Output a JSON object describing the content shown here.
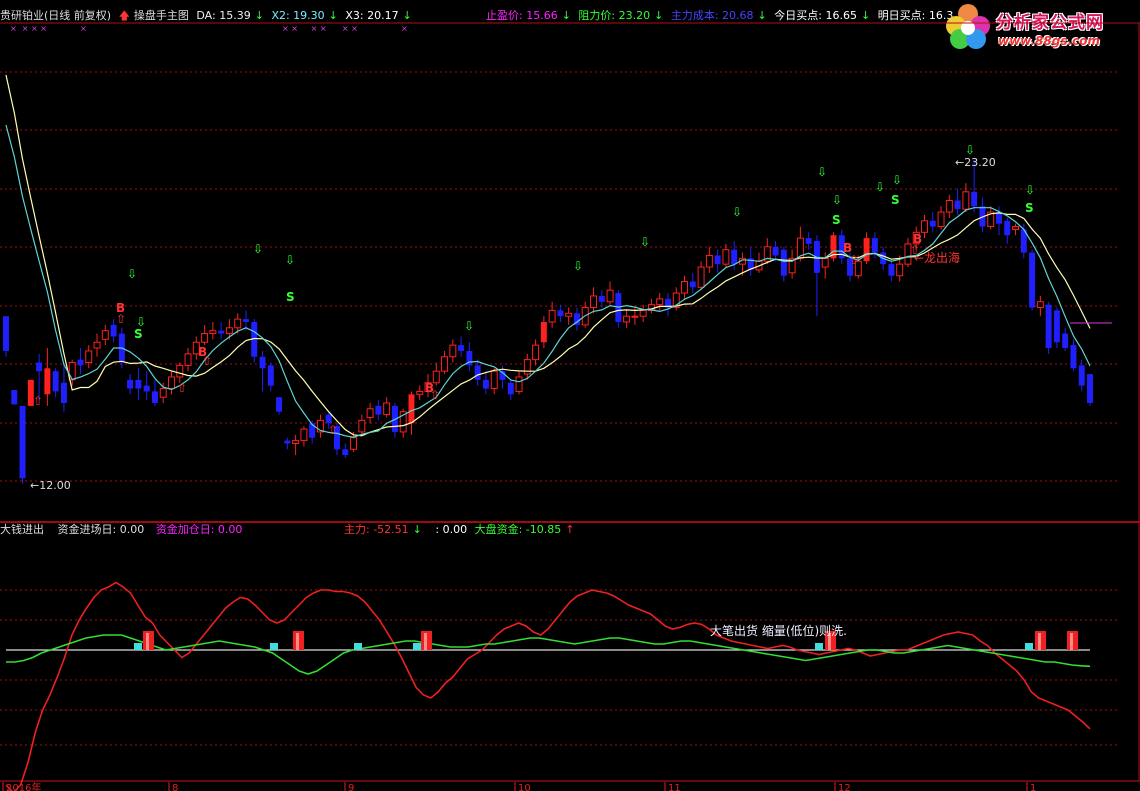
{
  "header": {
    "stock": "贵研铂业(日线 前复权)",
    "indicator": "操盘手主图",
    "da_label": "DA: 15.39",
    "x2_label": "X2: 19.30",
    "x3_label": "X3: 20.17",
    "stop_profit": "止盈价: 15.66",
    "resistance": "阻力价: 23.20",
    "main_cost": "主力成本: 20.68",
    "today_buy": "今日买点: 16.65",
    "tomorrow_buy": "明日买点: 16.3"
  },
  "logo": {
    "name": "分析家公式网",
    "url": "www.88gs.com"
  },
  "sub_header": {
    "name": "大钱进出",
    "fund_entry": "资金进场日: 0.00",
    "fund_add": "资金加仓日: 0.00",
    "main_force": "主力: -52.51",
    "blank_item": ": 0.00",
    "market_fund": "大盘资金: -10.85"
  },
  "colors": {
    "up": "#ff2020",
    "down": "#2020ff",
    "ma_yellow": "#ffffb0",
    "ma_cyan": "#5fd4d4",
    "grid": "#a01010",
    "green_line": "#33dd33",
    "red_line": "#ee2020"
  },
  "chart_data": [
    {
      "type": "candlestick",
      "annotations": {
        "low_label": "12.00",
        "high_label": "23.20",
        "dragon_label": "龙出海",
        "buy_mark": "B",
        "sell_mark": "S"
      },
      "ma_lines": [
        "yellow",
        "cyan"
      ],
      "candles": [
        {
          "o": 17.8,
          "c": 16.6,
          "h": 17.8,
          "l": 16.4
        },
        {
          "o": 15.25,
          "c": 14.75,
          "h": 15.25,
          "l": 14.75
        },
        {
          "o": 14.7,
          "c": 12.2,
          "h": 14.7,
          "l": 12.0
        },
        {
          "o": 14.7,
          "c": 15.6,
          "h": 15.6,
          "l": 14.7
        },
        {
          "o": 16.2,
          "c": 15.9,
          "h": 16.5,
          "l": 14.9
        },
        {
          "o": 15.1,
          "c": 16.0,
          "h": 16.7,
          "l": 14.7
        },
        {
          "o": 15.9,
          "c": 15.2,
          "h": 16.0,
          "l": 15.0
        },
        {
          "o": 15.5,
          "c": 14.8,
          "h": 16.2,
          "l": 14.5
        },
        {
          "o": 15.6,
          "c": 16.2,
          "h": 16.3,
          "l": 15.4
        },
        {
          "o": 16.3,
          "c": 16.1,
          "h": 16.7,
          "l": 15.8
        },
        {
          "o": 16.2,
          "c": 16.6,
          "h": 16.8,
          "l": 16.0
        },
        {
          "o": 16.7,
          "c": 16.9,
          "h": 17.2,
          "l": 16.4
        },
        {
          "o": 17.0,
          "c": 17.3,
          "h": 17.5,
          "l": 16.8
        },
        {
          "o": 17.5,
          "c": 17.1,
          "h": 17.7,
          "l": 16.9
        },
        {
          "o": 17.2,
          "c": 16.2,
          "h": 17.4,
          "l": 16.0
        },
        {
          "o": 15.6,
          "c": 15.3,
          "h": 15.8,
          "l": 15.1
        },
        {
          "o": 15.6,
          "c": 15.3,
          "h": 16.0,
          "l": 14.9
        },
        {
          "o": 15.4,
          "c": 15.2,
          "h": 15.9,
          "l": 14.9
        },
        {
          "o": 15.2,
          "c": 14.8,
          "h": 15.6,
          "l": 14.7
        },
        {
          "o": 15.0,
          "c": 15.3,
          "h": 15.5,
          "l": 14.8
        },
        {
          "o": 15.3,
          "c": 15.7,
          "h": 15.9,
          "l": 15.1
        },
        {
          "o": 15.7,
          "c": 16.1,
          "h": 16.2,
          "l": 15.5
        },
        {
          "o": 16.1,
          "c": 16.5,
          "h": 16.7,
          "l": 15.9
        },
        {
          "o": 16.5,
          "c": 16.9,
          "h": 17.1,
          "l": 16.3
        },
        {
          "o": 16.9,
          "c": 17.2,
          "h": 17.5,
          "l": 16.8
        },
        {
          "o": 17.2,
          "c": 17.3,
          "h": 17.6,
          "l": 17.0
        },
        {
          "o": 17.3,
          "c": 17.2,
          "h": 17.6,
          "l": 17.0
        },
        {
          "o": 17.2,
          "c": 17.4,
          "h": 17.7,
          "l": 17.0
        },
        {
          "o": 17.4,
          "c": 17.7,
          "h": 17.9,
          "l": 17.2
        },
        {
          "o": 17.7,
          "c": 17.6,
          "h": 18.0,
          "l": 17.3
        },
        {
          "o": 17.6,
          "c": 16.4,
          "h": 17.7,
          "l": 16.2
        },
        {
          "o": 16.4,
          "c": 16.0,
          "h": 16.6,
          "l": 15.2
        },
        {
          "o": 16.1,
          "c": 15.4,
          "h": 16.2,
          "l": 15.2
        },
        {
          "o": 15.0,
          "c": 14.5,
          "h": 15.0,
          "l": 14.4
        },
        {
          "o": 13.5,
          "c": 13.4,
          "h": 13.6,
          "l": 13.2
        },
        {
          "o": 13.4,
          "c": 13.5,
          "h": 13.7,
          "l": 13.0
        },
        {
          "o": 13.5,
          "c": 13.9,
          "h": 14.0,
          "l": 13.3
        },
        {
          "o": 14.1,
          "c": 13.6,
          "h": 14.2,
          "l": 13.4
        },
        {
          "o": 13.8,
          "c": 14.2,
          "h": 14.4,
          "l": 13.6
        },
        {
          "o": 14.4,
          "c": 14.1,
          "h": 14.5,
          "l": 13.9
        },
        {
          "o": 14.0,
          "c": 13.2,
          "h": 14.1,
          "l": 13.0
        },
        {
          "o": 13.2,
          "c": 13.0,
          "h": 13.4,
          "l": 12.9
        },
        {
          "o": 13.2,
          "c": 13.6,
          "h": 13.8,
          "l": 13.1
        },
        {
          "o": 13.8,
          "c": 14.2,
          "h": 14.4,
          "l": 13.7
        },
        {
          "o": 14.3,
          "c": 14.6,
          "h": 14.8,
          "l": 14.1
        },
        {
          "o": 14.7,
          "c": 14.4,
          "h": 14.9,
          "l": 14.2
        },
        {
          "o": 14.4,
          "c": 14.8,
          "h": 15.0,
          "l": 14.3
        },
        {
          "o": 14.7,
          "c": 13.8,
          "h": 14.8,
          "l": 13.6
        },
        {
          "o": 13.8,
          "c": 14.5,
          "h": 14.6,
          "l": 13.6
        },
        {
          "o": 14.1,
          "c": 15.1,
          "h": 15.2,
          "l": 13.7
        },
        {
          "o": 15.1,
          "c": 15.2,
          "h": 15.4,
          "l": 14.9
        },
        {
          "o": 15.2,
          "c": 15.5,
          "h": 15.8,
          "l": 15.0
        },
        {
          "o": 15.5,
          "c": 15.9,
          "h": 16.2,
          "l": 15.4
        },
        {
          "o": 15.9,
          "c": 16.4,
          "h": 16.6,
          "l": 15.8
        },
        {
          "o": 16.4,
          "c": 16.8,
          "h": 17.0,
          "l": 16.2
        },
        {
          "o": 16.8,
          "c": 16.6,
          "h": 17.1,
          "l": 16.4
        },
        {
          "o": 16.6,
          "c": 16.1,
          "h": 16.9,
          "l": 15.9
        },
        {
          "o": 16.1,
          "c": 15.6,
          "h": 16.3,
          "l": 15.4
        },
        {
          "o": 15.6,
          "c": 15.3,
          "h": 15.9,
          "l": 15.1
        },
        {
          "o": 15.3,
          "c": 15.9,
          "h": 16.0,
          "l": 15.1
        },
        {
          "o": 15.9,
          "c": 15.6,
          "h": 16.1,
          "l": 15.3
        },
        {
          "o": 15.5,
          "c": 15.1,
          "h": 15.6,
          "l": 14.9
        },
        {
          "o": 15.2,
          "c": 15.7,
          "h": 15.9,
          "l": 15.1
        },
        {
          "o": 15.8,
          "c": 16.3,
          "h": 16.5,
          "l": 15.6
        },
        {
          "o": 16.3,
          "c": 16.8,
          "h": 17.0,
          "l": 16.1
        },
        {
          "o": 16.9,
          "c": 17.6,
          "h": 17.8,
          "l": 16.7
        },
        {
          "o": 17.6,
          "c": 18.0,
          "h": 18.3,
          "l": 17.4
        },
        {
          "o": 18.0,
          "c": 17.8,
          "h": 18.2,
          "l": 17.6
        },
        {
          "o": 17.8,
          "c": 17.9,
          "h": 18.1,
          "l": 17.5
        },
        {
          "o": 17.9,
          "c": 17.5,
          "h": 18.1,
          "l": 17.3
        },
        {
          "o": 17.5,
          "c": 18.1,
          "h": 18.3,
          "l": 17.4
        },
        {
          "o": 18.1,
          "c": 18.5,
          "h": 18.8,
          "l": 17.9
        },
        {
          "o": 18.5,
          "c": 18.3,
          "h": 18.7,
          "l": 18.1
        },
        {
          "o": 18.3,
          "c": 18.7,
          "h": 19.0,
          "l": 18.2
        },
        {
          "o": 18.6,
          "c": 17.6,
          "h": 18.7,
          "l": 17.4
        },
        {
          "o": 17.6,
          "c": 17.8,
          "h": 18.0,
          "l": 17.4
        },
        {
          "o": 17.8,
          "c": 17.8,
          "h": 18.1,
          "l": 17.5
        },
        {
          "o": 17.8,
          "c": 18.0,
          "h": 18.2,
          "l": 17.6
        },
        {
          "o": 18.0,
          "c": 18.2,
          "h": 18.4,
          "l": 17.9
        },
        {
          "o": 18.2,
          "c": 18.4,
          "h": 18.6,
          "l": 18.0
        },
        {
          "o": 18.4,
          "c": 18.1,
          "h": 18.6,
          "l": 17.8
        },
        {
          "o": 18.1,
          "c": 18.6,
          "h": 18.8,
          "l": 18.0
        },
        {
          "o": 18.6,
          "c": 19.0,
          "h": 19.2,
          "l": 18.4
        },
        {
          "o": 19.0,
          "c": 18.8,
          "h": 19.3,
          "l": 18.6
        },
        {
          "o": 18.8,
          "c": 19.5,
          "h": 19.7,
          "l": 18.7
        },
        {
          "o": 19.5,
          "c": 19.9,
          "h": 20.2,
          "l": 19.3
        },
        {
          "o": 19.9,
          "c": 19.6,
          "h": 20.1,
          "l": 19.3
        },
        {
          "o": 19.6,
          "c": 20.1,
          "h": 20.3,
          "l": 19.5
        },
        {
          "o": 20.1,
          "c": 19.6,
          "h": 20.4,
          "l": 19.4
        },
        {
          "o": 19.6,
          "c": 19.8,
          "h": 20.0,
          "l": 19.2
        },
        {
          "o": 19.8,
          "c": 19.4,
          "h": 20.2,
          "l": 19.2
        },
        {
          "o": 19.4,
          "c": 19.7,
          "h": 20.0,
          "l": 19.3
        },
        {
          "o": 19.7,
          "c": 20.2,
          "h": 20.5,
          "l": 19.6
        },
        {
          "o": 20.2,
          "c": 19.9,
          "h": 20.4,
          "l": 19.7
        },
        {
          "o": 20.1,
          "c": 19.2,
          "h": 20.2,
          "l": 19.0
        },
        {
          "o": 19.3,
          "c": 19.8,
          "h": 20.1,
          "l": 19.1
        },
        {
          "o": 19.8,
          "c": 20.5,
          "h": 20.9,
          "l": 19.7
        },
        {
          "o": 20.5,
          "c": 20.3,
          "h": 20.7,
          "l": 20.1
        },
        {
          "o": 20.4,
          "c": 19.3,
          "h": 20.6,
          "l": 17.8
        },
        {
          "o": 19.5,
          "c": 19.8,
          "h": 20.0,
          "l": 19.1
        },
        {
          "o": 19.8,
          "c": 20.6,
          "h": 20.7,
          "l": 19.7
        },
        {
          "o": 20.6,
          "c": 19.8,
          "h": 20.8,
          "l": 19.6
        },
        {
          "o": 19.8,
          "c": 19.2,
          "h": 20.0,
          "l": 19.0
        },
        {
          "o": 19.2,
          "c": 19.7,
          "h": 19.9,
          "l": 19.1
        },
        {
          "o": 19.7,
          "c": 20.5,
          "h": 20.7,
          "l": 19.6
        },
        {
          "o": 20.5,
          "c": 20.0,
          "h": 20.7,
          "l": 19.8
        },
        {
          "o": 20.0,
          "c": 19.6,
          "h": 20.2,
          "l": 19.4
        },
        {
          "o": 19.6,
          "c": 19.2,
          "h": 19.8,
          "l": 19.0
        },
        {
          "o": 19.2,
          "c": 19.6,
          "h": 19.9,
          "l": 19.0
        },
        {
          "o": 19.6,
          "c": 20.3,
          "h": 20.5,
          "l": 19.5
        },
        {
          "o": 20.3,
          "c": 20.7,
          "h": 20.9,
          "l": 20.1
        },
        {
          "o": 20.7,
          "c": 21.1,
          "h": 21.3,
          "l": 20.5
        },
        {
          "o": 21.1,
          "c": 20.9,
          "h": 21.4,
          "l": 20.7
        },
        {
          "o": 20.9,
          "c": 21.4,
          "h": 21.6,
          "l": 20.8
        },
        {
          "o": 21.4,
          "c": 21.8,
          "h": 22.0,
          "l": 21.2
        },
        {
          "o": 21.8,
          "c": 21.5,
          "h": 22.2,
          "l": 21.3
        },
        {
          "o": 21.5,
          "c": 22.1,
          "h": 22.4,
          "l": 21.4
        },
        {
          "o": 22.1,
          "c": 21.6,
          "h": 23.2,
          "l": 21.4
        },
        {
          "o": 21.6,
          "c": 20.9,
          "h": 21.9,
          "l": 20.7
        },
        {
          "o": 20.9,
          "c": 21.4,
          "h": 21.6,
          "l": 20.8
        },
        {
          "o": 21.4,
          "c": 21.0,
          "h": 21.6,
          "l": 20.6
        },
        {
          "o": 21.1,
          "c": 20.6,
          "h": 21.2,
          "l": 20.3
        },
        {
          "o": 20.8,
          "c": 20.9,
          "h": 21.0,
          "l": 20.6
        },
        {
          "o": 20.8,
          "c": 20.0,
          "h": 21.0,
          "l": 19.8
        },
        {
          "o": 20.0,
          "c": 18.1,
          "h": 20.1,
          "l": 18.0
        },
        {
          "o": 18.1,
          "c": 18.3,
          "h": 18.5,
          "l": 17.8
        },
        {
          "o": 18.2,
          "c": 16.7,
          "h": 18.3,
          "l": 16.5
        },
        {
          "o": 18.0,
          "c": 16.9,
          "h": 18.1,
          "l": 16.7
        },
        {
          "o": 17.2,
          "c": 16.7,
          "h": 17.4,
          "l": 16.6
        },
        {
          "o": 16.8,
          "c": 16.0,
          "h": 17.0,
          "l": 15.9
        },
        {
          "o": 16.1,
          "c": 15.4,
          "h": 16.3,
          "l": 15.2
        },
        {
          "o": 15.8,
          "c": 14.8,
          "h": 15.8,
          "l": 14.7
        }
      ]
    },
    {
      "type": "line",
      "annotations": {
        "note": "大笔出货 缩量(低位)则洗."
      },
      "series": [
        {
          "values": [
            -90,
            -95,
            -90,
            -75,
            -55,
            -40,
            -30,
            -18,
            -5,
            10,
            20,
            28,
            35,
            40,
            42,
            45,
            42,
            38,
            30,
            22,
            18,
            10,
            5,
            0,
            -5,
            -2,
            4,
            10,
            16,
            22,
            28,
            32,
            35,
            34,
            30,
            25,
            20,
            18,
            20,
            25,
            30,
            35,
            38,
            40,
            40,
            39,
            39,
            38,
            36,
            32,
            26,
            20,
            12,
            4,
            -5,
            -15,
            -25,
            -30,
            -32,
            -28,
            -22,
            -18,
            -12,
            -6,
            -3,
            0,
            5,
            10,
            14,
            16,
            18,
            16,
            12,
            10,
            14,
            20,
            26,
            32,
            36,
            38,
            40,
            39,
            38,
            36,
            33,
            30,
            28,
            26,
            24,
            20,
            16,
            14,
            15,
            17,
            18,
            17,
            14,
            10,
            8,
            6,
            5,
            4,
            3,
            2,
            1,
            2,
            3,
            2,
            0,
            -1,
            -2,
            -3,
            -2,
            -1,
            0,
            1,
            0,
            -2,
            -4,
            -3,
            -2,
            -1,
            0,
            0,
            2,
            4,
            6,
            8,
            10,
            11,
            12,
            11,
            10,
            6,
            3,
            -2,
            -6,
            -10,
            -14,
            -20,
            -28,
            -32,
            -34,
            -36,
            -38,
            -40,
            -44,
            -48,
            -52.51
          ]
        },
        {
          "values": [
            -8,
            -8,
            -7,
            -5,
            -2,
            0,
            2,
            4,
            6,
            8,
            9,
            10,
            10,
            10,
            8,
            6,
            4,
            2,
            0,
            1,
            2,
            3,
            4,
            5,
            6,
            5,
            4,
            3,
            2,
            0,
            -2,
            -6,
            -10,
            -14,
            -16,
            -14,
            -10,
            -6,
            -2,
            0,
            1,
            2,
            3,
            4,
            5,
            6,
            6,
            5,
            4,
            3,
            2,
            2,
            2,
            3,
            4,
            4,
            5,
            6,
            7,
            8,
            8,
            7,
            6,
            5,
            4,
            5,
            6,
            7,
            8,
            8,
            7,
            6,
            5,
            4,
            4,
            5,
            6,
            6,
            5,
            4,
            3,
            2,
            1,
            0,
            -1,
            -2,
            -3,
            -4,
            -5,
            -6,
            -7,
            -6,
            -5,
            -4,
            -3,
            -2,
            -1,
            0,
            0,
            -1,
            -2,
            -2,
            -1,
            0,
            1,
            2,
            3,
            2,
            1,
            0,
            -1,
            -2,
            -3,
            -4,
            -5,
            -6,
            -7,
            -8,
            -8,
            -9,
            -10,
            -10.5,
            -10.85
          ]
        }
      ],
      "zero_line": 0
    }
  ],
  "x_axis_labels": [
    "2016年",
    "8",
    "9",
    "10",
    "11",
    "12",
    "1"
  ]
}
